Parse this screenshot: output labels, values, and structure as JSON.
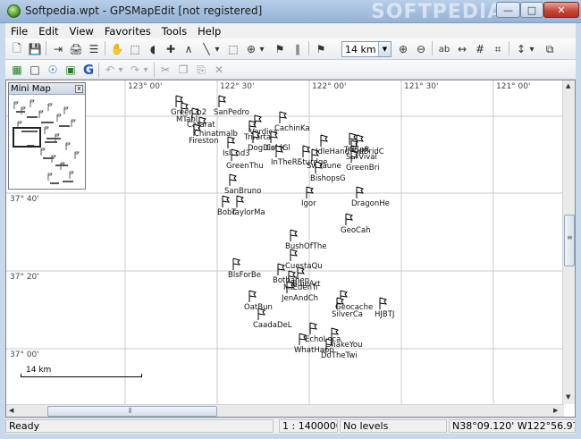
{
  "window": {
    "title": "Softpedia.wpt - GPSMapEdit [not registered]",
    "watermark": "SOFTPEDIA",
    "minimize_glyph": "—",
    "maximize_glyph": "□",
    "close_glyph": "✕"
  },
  "menu": [
    "File",
    "Edit",
    "View",
    "Favorites",
    "Tools",
    "Help"
  ],
  "toolbar": {
    "zoom_value": "14 km",
    "zoom_arrow": "▼",
    "buttons1": [
      {
        "icon": "new-icon",
        "glyph": "🗋"
      },
      {
        "icon": "save-icon",
        "glyph": "💾"
      },
      {
        "icon": "export-icon",
        "glyph": "⇥"
      },
      {
        "icon": "print-icon",
        "glyph": "🖨"
      },
      {
        "icon": "properties-icon",
        "glyph": "☰"
      },
      {
        "icon": "hand-pan-icon",
        "glyph": "✋"
      },
      {
        "icon": "select-icon",
        "glyph": "⬚"
      },
      {
        "icon": "edit-node-icon",
        "glyph": "◖"
      },
      {
        "icon": "move-icon",
        "glyph": "✚"
      },
      {
        "icon": "create-polyline-icon",
        "glyph": "∧"
      },
      {
        "icon": "create-polygon-icon",
        "glyph": "╲"
      },
      {
        "icon": "dropdown-arrow-icon",
        "glyph": "▾"
      },
      {
        "icon": "select-rect-icon",
        "glyph": "⬚"
      },
      {
        "icon": "track-icon",
        "glyph": "⊕"
      },
      {
        "icon": "dropdown-arrow-icon",
        "glyph": "▾"
      },
      {
        "icon": "waypoint-icon",
        "glyph": "⚑"
      },
      {
        "icon": "measure-icon",
        "glyph": "∥"
      },
      {
        "icon": "zoom-in-icon",
        "glyph": "⊕"
      },
      {
        "icon": "zoom-out-icon",
        "glyph": "⊖"
      },
      {
        "icon": "labels-icon",
        "glyph": "ab"
      },
      {
        "icon": "scale-icon",
        "glyph": "↔"
      },
      {
        "icon": "grid-icon",
        "glyph": "#"
      },
      {
        "icon": "grid-lines-icon",
        "glyph": "⌗"
      },
      {
        "icon": "routing-icon",
        "glyph": "↕"
      },
      {
        "icon": "dropdown-arrow-icon",
        "glyph": "▾"
      },
      {
        "icon": "windows-icon",
        "glyph": "⧉"
      }
    ],
    "buttons2": [
      {
        "icon": "map-icon",
        "glyph": "▦"
      },
      {
        "icon": "document-icon",
        "glyph": "□"
      },
      {
        "icon": "gps-icon",
        "glyph": "☉"
      },
      {
        "icon": "gps-device-icon",
        "glyph": "▣"
      },
      {
        "icon": "google-icon",
        "glyph": "G"
      },
      {
        "icon": "undo-icon",
        "glyph": "↶"
      },
      {
        "icon": "undo-dropdown-icon",
        "glyph": "▾"
      },
      {
        "icon": "redo-icon",
        "glyph": "↷"
      },
      {
        "icon": "redo-dropdown-icon",
        "glyph": "▾"
      },
      {
        "icon": "cut-icon",
        "glyph": "✂"
      },
      {
        "icon": "copy-icon",
        "glyph": "❐"
      },
      {
        "icon": "paste-icon",
        "glyph": "⎘"
      },
      {
        "icon": "delete-icon",
        "glyph": "✕"
      }
    ]
  },
  "map": {
    "lon_labels": [
      "123° 00'",
      "122° 30'",
      "122° 00'",
      "121° 30'",
      "121° 00'"
    ],
    "lat_labels": [
      "37° 40'",
      "37° 20'",
      "37° 00'"
    ],
    "scale_label": "14 km",
    "minimap_title": "Mini Map",
    "minimap_close": "x",
    "waypoints": [
      "GreenTo2",
      "MTabl",
      "Catarat",
      "Chinatmalb",
      "Fireston",
      "SanPedro",
      "Verdica",
      "Triferta",
      "DogDistor",
      "ColdGl",
      "CachinKa",
      "Island3",
      "InTheRi",
      "Sturdge",
      "Sweaune",
      "GreenThu",
      "IdleHand",
      "TGSpR",
      "SurVival",
      "RidBridC",
      "GreenBri",
      "BishopsG",
      "SanBruno",
      "Igor",
      "DragonHe",
      "Bobc",
      "TaylorMa",
      "GeoCah",
      "BushOfThe",
      "CuestaQu",
      "BlsForBe",
      "Bothahen",
      "BlueArt",
      "MtEdenTr",
      "JenAndCh",
      "Geocache",
      "SilverCa",
      "HJBTJ",
      "OatBun",
      "CaadaDeL",
      "EchoLoca",
      "ShakeYou",
      "WhatHapp",
      "DoTheTwi"
    ]
  },
  "status": {
    "state": "Ready",
    "scale": "1 : 1400000",
    "levels": "No levels",
    "coords": "N38°09.120' W122°56.971'"
  }
}
